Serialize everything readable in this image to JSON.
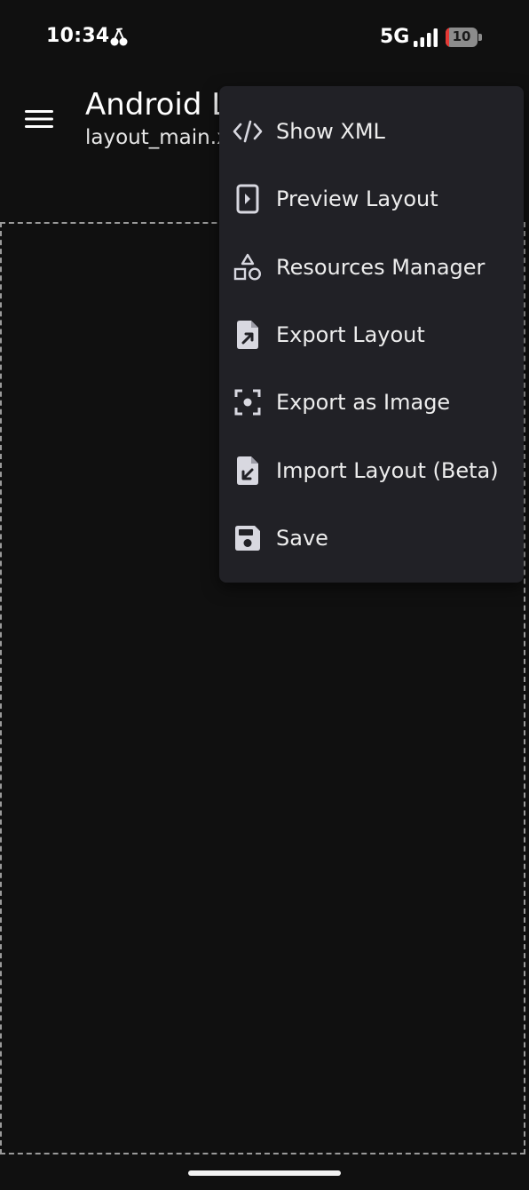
{
  "status_bar": {
    "time": "10:34",
    "network": "5G",
    "battery_level": "10",
    "battery_fraction": 0.1,
    "app_icon": "cherries-icon",
    "signal_icon": "signal-bars-icon"
  },
  "app_bar": {
    "menu_icon": "hamburger-menu-icon",
    "title": "Android L",
    "subtitle": "layout_main.x"
  },
  "dropdown": {
    "items": [
      {
        "label": "Show XML",
        "icon": "code-icon"
      },
      {
        "label": "Preview Layout",
        "icon": "preview-icon"
      },
      {
        "label": "Resources Manager",
        "icon": "shapes-icon"
      },
      {
        "label": "Export Layout",
        "icon": "file-export-icon"
      },
      {
        "label": "Export as Image",
        "icon": "screenshot-frame-icon"
      },
      {
        "label": "Import Layout (Beta)",
        "icon": "file-import-icon"
      },
      {
        "label": "Save",
        "icon": "save-icon"
      }
    ]
  },
  "colors": {
    "background": "#101010",
    "menu_surface": "#212126",
    "icon": "#D8D8E0",
    "battery_low": "#E53935"
  }
}
